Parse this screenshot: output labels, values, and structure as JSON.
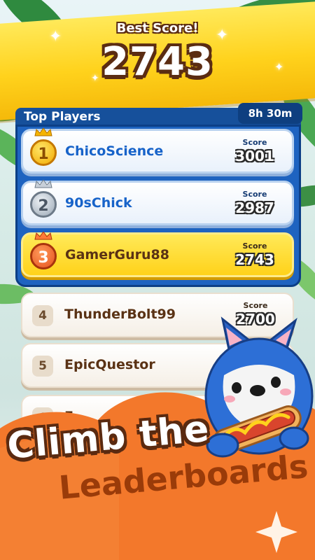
{
  "header": {
    "best_score_label": "Best Score!",
    "best_score_value": "2743"
  },
  "top_players": {
    "title": "Top Players",
    "timer": "8h 30m",
    "entries": [
      {
        "rank": "1",
        "name": "ChicoScience",
        "score_label": "Score",
        "score": "3001",
        "medal": "gold-crown-medal"
      },
      {
        "rank": "2",
        "name": "90sChick",
        "score_label": "Score",
        "score": "2987",
        "medal": "silver-crown-medal"
      },
      {
        "rank": "3",
        "name": "GamerGuru88",
        "score_label": "Score",
        "score": "2743",
        "medal": "bronze-crown-medal"
      }
    ]
  },
  "others": [
    {
      "rank": "4",
      "name": "ThunderBolt99",
      "score_label": "Score",
      "score": "2700"
    },
    {
      "rank": "5",
      "name": "EpicQuestor"
    },
    {
      "rank": "6",
      "name": "E"
    }
  ],
  "promo": {
    "line1": "Climb the",
    "line2": "Leaderboards"
  },
  "mascot": "husky-with-hotdog",
  "colors": {
    "banner": "#ffd21c",
    "panel": "#1e63c0",
    "highlight_row": "#ffd21a",
    "orange": "#f3782b",
    "outline": "#5a2a10"
  }
}
